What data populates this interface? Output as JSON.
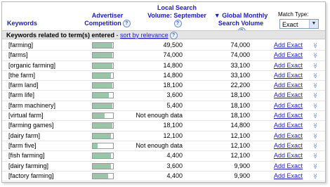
{
  "header": {
    "keywords": "Keywords",
    "advertiser_line1": "Advertiser",
    "advertiser_line2": "Competition",
    "local_line1": "Local Search",
    "local_line2": "Volume: September",
    "global_line1": "▼ Global Monthly",
    "global_line2": "Search Volume",
    "match_type_label": "Match Type:",
    "match_type_value": "Exact"
  },
  "section": {
    "text": "Keywords related to term(s) entered",
    "sep": " - ",
    "sort_link": "sort by relevance"
  },
  "rows": [
    {
      "keyword": "[farming]",
      "competition": 0.95,
      "local": "49,500",
      "global": "74,000",
      "action": "Add Exact"
    },
    {
      "keyword": "[farms]",
      "competition": 0.95,
      "local": "74,000",
      "global": "74,000",
      "action": "Add Exact"
    },
    {
      "keyword": "[organic farming]",
      "competition": 0.95,
      "local": "14,800",
      "global": "33,100",
      "action": "Add Exact"
    },
    {
      "keyword": "[the farm]",
      "competition": 0.88,
      "local": "14,800",
      "global": "33,100",
      "action": "Add Exact"
    },
    {
      "keyword": "[farm land]",
      "competition": 0.95,
      "local": "18,100",
      "global": "22,200",
      "action": "Add Exact"
    },
    {
      "keyword": "[farm life]",
      "competition": 0.8,
      "local": "3,600",
      "global": "18,100",
      "action": "Add Exact"
    },
    {
      "keyword": "[farm machinery]",
      "competition": 0.95,
      "local": "5,400",
      "global": "18,100",
      "action": "Add Exact"
    },
    {
      "keyword": "[virtual farm]",
      "competition": 0.6,
      "local": "Not enough data",
      "global": "18,100",
      "action": "Add Exact"
    },
    {
      "keyword": "[farming games]",
      "competition": 0.95,
      "local": "18,100",
      "global": "14,800",
      "action": "Add Exact"
    },
    {
      "keyword": "[dairy farm]",
      "competition": 0.9,
      "local": "12,100",
      "global": "12,100",
      "action": "Add Exact"
    },
    {
      "keyword": "[farm five]",
      "competition": 0.25,
      "local": "Not enough data",
      "global": "12,100",
      "action": "Add Exact"
    },
    {
      "keyword": "[fish farming]",
      "competition": 0.88,
      "local": "4,400",
      "global": "12,100",
      "action": "Add Exact"
    },
    {
      "keyword": "[dairy farming]",
      "competition": 0.9,
      "local": "3,600",
      "global": "9,900",
      "action": "Add Exact"
    },
    {
      "keyword": "[factory farming]",
      "competition": 0.75,
      "local": "4,400",
      "global": "9,900",
      "action": "Add Exact"
    }
  ],
  "colors": {
    "bar_fill": "#99c6a8",
    "link": "#1a1ad0",
    "section_bg": "#e4e4e4"
  },
  "icons": {
    "help": "question-circle-icon",
    "chevron": "double-chevron-down-icon"
  }
}
